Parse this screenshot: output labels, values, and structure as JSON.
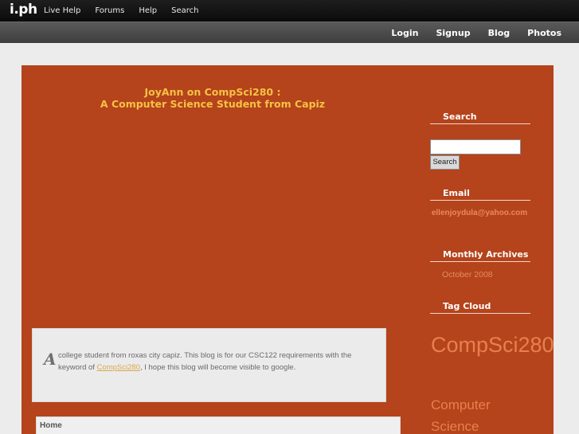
{
  "topbar": {
    "logo": "i.ph",
    "links": [
      "Live Help",
      "Forums",
      "Help",
      "Search"
    ]
  },
  "secondbar": {
    "links": [
      "Login",
      "Signup",
      "Blog",
      "Photos"
    ]
  },
  "blog": {
    "title_line1": "JoyAnn on CompSci280 :",
    "title_line2": "A Computer Science Student from Capiz",
    "dropcap": "A",
    "description_pre": "college student from roxas city capiz. This blog is for our CSC122 requirements with the keyword of ",
    "description_link": "CompSci280",
    "description_post": ", I hope this blog will become visible to google.",
    "home_label": "Home"
  },
  "sidebar": {
    "search_heading": "Search",
    "search_value": "",
    "search_button": "Search",
    "email_heading": "Email",
    "email": "ellenjoydula@yahoo.com",
    "archives_heading": "Monthly Archives",
    "archive_item": "October 2008",
    "tagcloud_heading": "Tag Cloud",
    "tag_large": "CompSci280",
    "tag_medium": "Computer Science"
  },
  "colors": {
    "panel": "#b5431b",
    "title": "#f6c244",
    "accent_link": "#e7804f"
  }
}
